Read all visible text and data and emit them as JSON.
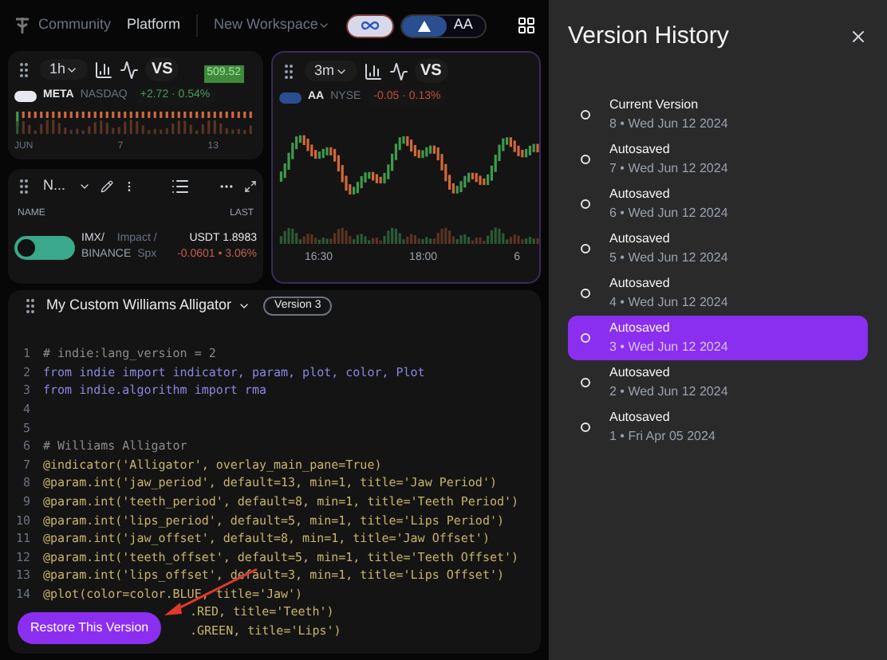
{
  "topbar": {
    "community": "Community",
    "platform": "Platform",
    "workspace": "New Workspace",
    "infinity_toggle": {
      "on": true
    },
    "ticker_pill": "AA"
  },
  "chart_a": {
    "interval": "1h",
    "vs": "VS",
    "symbol": "META",
    "exchange": "NASDAQ",
    "change": "+2.72 · 0.54%",
    "color": "#4b9c5a",
    "price_tag": "509.52",
    "x_labels": [
      "JUN",
      "7",
      "13"
    ]
  },
  "watchlist": {
    "title": "N...",
    "columns": [
      "NAME",
      "LAST"
    ],
    "rows": [
      {
        "symbol": "IMX/",
        "name": "Impact /",
        "last": "USDT 1.8983",
        "exchange": "BINANCE",
        "sub": "Spx",
        "change": "-0.0601 • 3.06%"
      }
    ]
  },
  "chart_b": {
    "interval": "3m",
    "vs": "VS",
    "symbol": "AA",
    "exchange": "NYSE",
    "change": "-0.05 · 0.13%",
    "color": "#c0503c",
    "x_labels": [
      "16:30",
      "18:00",
      "6"
    ]
  },
  "editor": {
    "title": "My Custom Williams Alligator",
    "version": "Version 3",
    "restore_button": "Restore This Version",
    "lines": [
      {
        "number": "1",
        "code": "# indie:lang_version = 2",
        "kind": "comment"
      },
      {
        "number": "2",
        "code": "from indie import indicator, param, plot, color, Plot",
        "kind": "import"
      },
      {
        "number": "3",
        "code": "from indie.algorithm import rma",
        "kind": "import"
      },
      {
        "number": "4"
      },
      {
        "number": "5"
      },
      {
        "number": "6",
        "code": "# Williams Alligator",
        "kind": "comment"
      },
      {
        "number": "7",
        "code": "@indicator('Alligator', overlay_main_pane=True)",
        "kind": "decorator"
      },
      {
        "number": "8",
        "code": "@param.int('jaw_period', default=13, min=1, title='Jaw Period')",
        "kind": "decorator"
      },
      {
        "number": "9",
        "code": "@param.int('teeth_period', default=8, min=1, title='Teeth Period')",
        "kind": "decorator"
      },
      {
        "number": "10",
        "code": "@param.int('lips_period', default=5, min=1, title='Lips Period')",
        "kind": "decorator"
      },
      {
        "number": "11",
        "code": "@param.int('jaw_offset', default=8, min=1, title='Jaw Offset')",
        "kind": "decorator"
      },
      {
        "number": "12",
        "code": "@param.int('teeth_offset', default=5, min=1, title='Teeth Offset')",
        "kind": "decorator"
      },
      {
        "number": "13",
        "code": "@param.int('lips_offset', default=3, min=1, title='Lips Offset')",
        "kind": "decorator"
      },
      {
        "number": "14",
        "code": "@plot(color=color.BLUE, title='Jaw')",
        "kind": "decorator"
      },
      {
        "code": ".RED, title='Teeth')",
        "kind": "partial"
      },
      {
        "code": ".GREEN, title='Lips')",
        "kind": "partial"
      }
    ]
  },
  "version_history": {
    "title": "Version History",
    "items": [
      {
        "title": "Current Version",
        "subtitle": "8 • Wed Jun 12 2024",
        "selected": false
      },
      {
        "title": "Autosaved",
        "subtitle": "7 • Wed Jun 12 2024",
        "selected": false
      },
      {
        "title": "Autosaved",
        "subtitle": "6 • Wed Jun 12 2024",
        "selected": false
      },
      {
        "title": "Autosaved",
        "subtitle": "5 • Wed Jun 12 2024",
        "selected": false
      },
      {
        "title": "Autosaved",
        "subtitle": "4 • Wed Jun 12 2024",
        "selected": false
      },
      {
        "title": "Autosaved",
        "subtitle": "3 • Wed Jun 12 2024",
        "selected": true
      },
      {
        "title": "Autosaved",
        "subtitle": "2 • Wed Jun 12 2024",
        "selected": false
      },
      {
        "title": "Autosaved",
        "subtitle": "1 • Fri Apr 05 2024",
        "selected": false
      }
    ]
  }
}
